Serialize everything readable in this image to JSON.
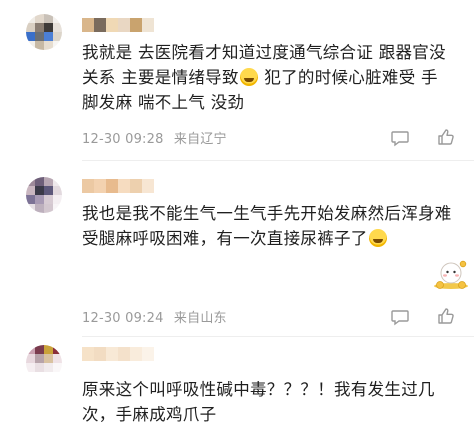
{
  "comments": [
    {
      "text_before": "我就是 去医院看才知道过度通气综合证 跟器官没关系 主要是情绪导致",
      "text_after": " 犯了的时候心脏难受 手脚发麻 喘不上气 没劲",
      "time": "12-30 09:28",
      "location": "来自辽宁",
      "emoji": "grinning-sweat-emoji"
    },
    {
      "text_before": "我也是我不能生气一生气手先开始发麻然后浑身难受腿麻呼吸困难，有一次直接尿裤子了",
      "text_after": "",
      "time": "12-30 09:24",
      "location": "来自山东",
      "emoji": "crying-emoji"
    },
    {
      "text_before": "原来这个叫呼吸性碱中毒？？？！我有发生过几次，手麻成鸡爪子",
      "text_after": ""
    }
  ],
  "icons": {
    "comment": "comment-bubble-icon",
    "like": "thumbs-up-icon",
    "sticker": "cartoon-sticker"
  },
  "colors": {
    "meta_text": "#9a9a9a",
    "divider": "#eeeeee"
  }
}
